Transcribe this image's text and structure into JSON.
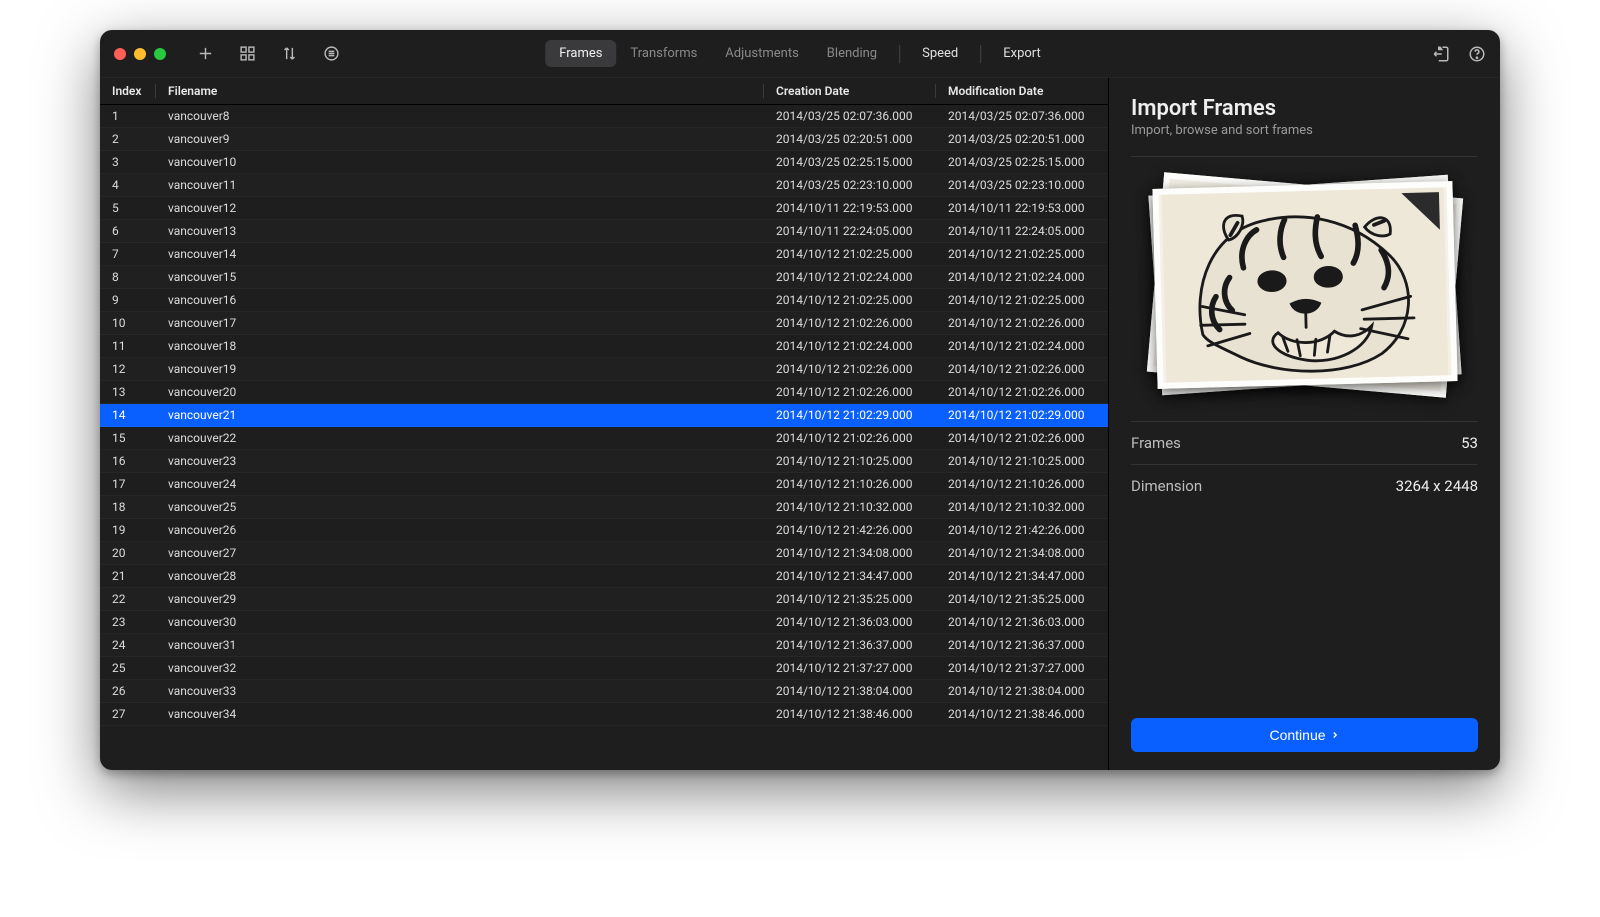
{
  "tabs": {
    "frames": "Frames",
    "transforms": "Transforms",
    "adjustments": "Adjustments",
    "blending": "Blending",
    "speed": "Speed",
    "export": "Export"
  },
  "table": {
    "headers": {
      "index": "Index",
      "filename": "Filename",
      "created": "Creation Date",
      "modified": "Modification Date"
    },
    "rows": [
      {
        "index": "1",
        "filename": "vancouver8",
        "created": "2014/03/25 02:07:36.000",
        "modified": "2014/03/25 02:07:36.000"
      },
      {
        "index": "2",
        "filename": "vancouver9",
        "created": "2014/03/25 02:20:51.000",
        "modified": "2014/03/25 02:20:51.000"
      },
      {
        "index": "3",
        "filename": "vancouver10",
        "created": "2014/03/25 02:25:15.000",
        "modified": "2014/03/25 02:25:15.000"
      },
      {
        "index": "4",
        "filename": "vancouver11",
        "created": "2014/03/25 02:23:10.000",
        "modified": "2014/03/25 02:23:10.000"
      },
      {
        "index": "5",
        "filename": "vancouver12",
        "created": "2014/10/11 22:19:53.000",
        "modified": "2014/10/11 22:19:53.000"
      },
      {
        "index": "6",
        "filename": "vancouver13",
        "created": "2014/10/11 22:24:05.000",
        "modified": "2014/10/11 22:24:05.000"
      },
      {
        "index": "7",
        "filename": "vancouver14",
        "created": "2014/10/12 21:02:25.000",
        "modified": "2014/10/12 21:02:25.000"
      },
      {
        "index": "8",
        "filename": "vancouver15",
        "created": "2014/10/12 21:02:24.000",
        "modified": "2014/10/12 21:02:24.000"
      },
      {
        "index": "9",
        "filename": "vancouver16",
        "created": "2014/10/12 21:02:25.000",
        "modified": "2014/10/12 21:02:25.000"
      },
      {
        "index": "10",
        "filename": "vancouver17",
        "created": "2014/10/12 21:02:26.000",
        "modified": "2014/10/12 21:02:26.000"
      },
      {
        "index": "11",
        "filename": "vancouver18",
        "created": "2014/10/12 21:02:24.000",
        "modified": "2014/10/12 21:02:24.000"
      },
      {
        "index": "12",
        "filename": "vancouver19",
        "created": "2014/10/12 21:02:26.000",
        "modified": "2014/10/12 21:02:26.000"
      },
      {
        "index": "13",
        "filename": "vancouver20",
        "created": "2014/10/12 21:02:26.000",
        "modified": "2014/10/12 21:02:26.000"
      },
      {
        "index": "14",
        "filename": "vancouver21",
        "created": "2014/10/12 21:02:29.000",
        "modified": "2014/10/12 21:02:29.000",
        "selected": true
      },
      {
        "index": "15",
        "filename": "vancouver22",
        "created": "2014/10/12 21:02:26.000",
        "modified": "2014/10/12 21:02:26.000"
      },
      {
        "index": "16",
        "filename": "vancouver23",
        "created": "2014/10/12 21:10:25.000",
        "modified": "2014/10/12 21:10:25.000"
      },
      {
        "index": "17",
        "filename": "vancouver24",
        "created": "2014/10/12 21:10:26.000",
        "modified": "2014/10/12 21:10:26.000"
      },
      {
        "index": "18",
        "filename": "vancouver25",
        "created": "2014/10/12 21:10:32.000",
        "modified": "2014/10/12 21:10:32.000"
      },
      {
        "index": "19",
        "filename": "vancouver26",
        "created": "2014/10/12 21:42:26.000",
        "modified": "2014/10/12 21:42:26.000"
      },
      {
        "index": "20",
        "filename": "vancouver27",
        "created": "2014/10/12 21:34:08.000",
        "modified": "2014/10/12 21:34:08.000"
      },
      {
        "index": "21",
        "filename": "vancouver28",
        "created": "2014/10/12 21:34:47.000",
        "modified": "2014/10/12 21:34:47.000"
      },
      {
        "index": "22",
        "filename": "vancouver29",
        "created": "2014/10/12 21:35:25.000",
        "modified": "2014/10/12 21:35:25.000"
      },
      {
        "index": "23",
        "filename": "vancouver30",
        "created": "2014/10/12 21:36:03.000",
        "modified": "2014/10/12 21:36:03.000"
      },
      {
        "index": "24",
        "filename": "vancouver31",
        "created": "2014/10/12 21:36:37.000",
        "modified": "2014/10/12 21:36:37.000"
      },
      {
        "index": "25",
        "filename": "vancouver32",
        "created": "2014/10/12 21:37:27.000",
        "modified": "2014/10/12 21:37:27.000"
      },
      {
        "index": "26",
        "filename": "vancouver33",
        "created": "2014/10/12 21:38:04.000",
        "modified": "2014/10/12 21:38:04.000"
      },
      {
        "index": "27",
        "filename": "vancouver34",
        "created": "2014/10/12 21:38:46.000",
        "modified": "2014/10/12 21:38:46.000"
      }
    ]
  },
  "sidebar": {
    "title": "Import Frames",
    "subtitle": "Import, browse and sort frames",
    "frames_label": "Frames",
    "frames_value": "53",
    "dimension_label": "Dimension",
    "dimension_value": "3264 x 2448",
    "continue_label": "Continue"
  }
}
